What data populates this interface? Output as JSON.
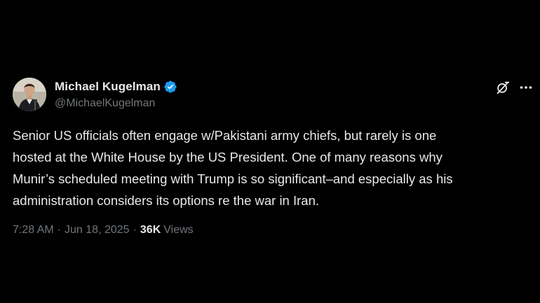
{
  "tweet": {
    "author": {
      "name": "Michael Kugelman",
      "handle": "@MichaelKugelman",
      "verified_icon": "verified-badge-icon",
      "avatar": "avatar-photo"
    },
    "actions": {
      "grok_icon": "grok-icon",
      "more_icon": "more-options-icon"
    },
    "text": "Senior US officials often engage w/Pakistani army chiefs, but rarely is one\nhosted at the White House by the US President. One of many reasons why\nMunir’s scheduled meeting with Trump is so significant–and especially as his\nadministration considers its options re the war in Iran.",
    "time": "7:28 AM",
    "separator_1": "·",
    "date": "Jun 18, 2025",
    "separator_2": "·",
    "views_count": "36K",
    "views_label": "Views"
  },
  "colors": {
    "background": "#000000",
    "text_primary": "#e7e9ea",
    "text_secondary": "#71767b",
    "verified_blue": "#1d9bf0"
  }
}
